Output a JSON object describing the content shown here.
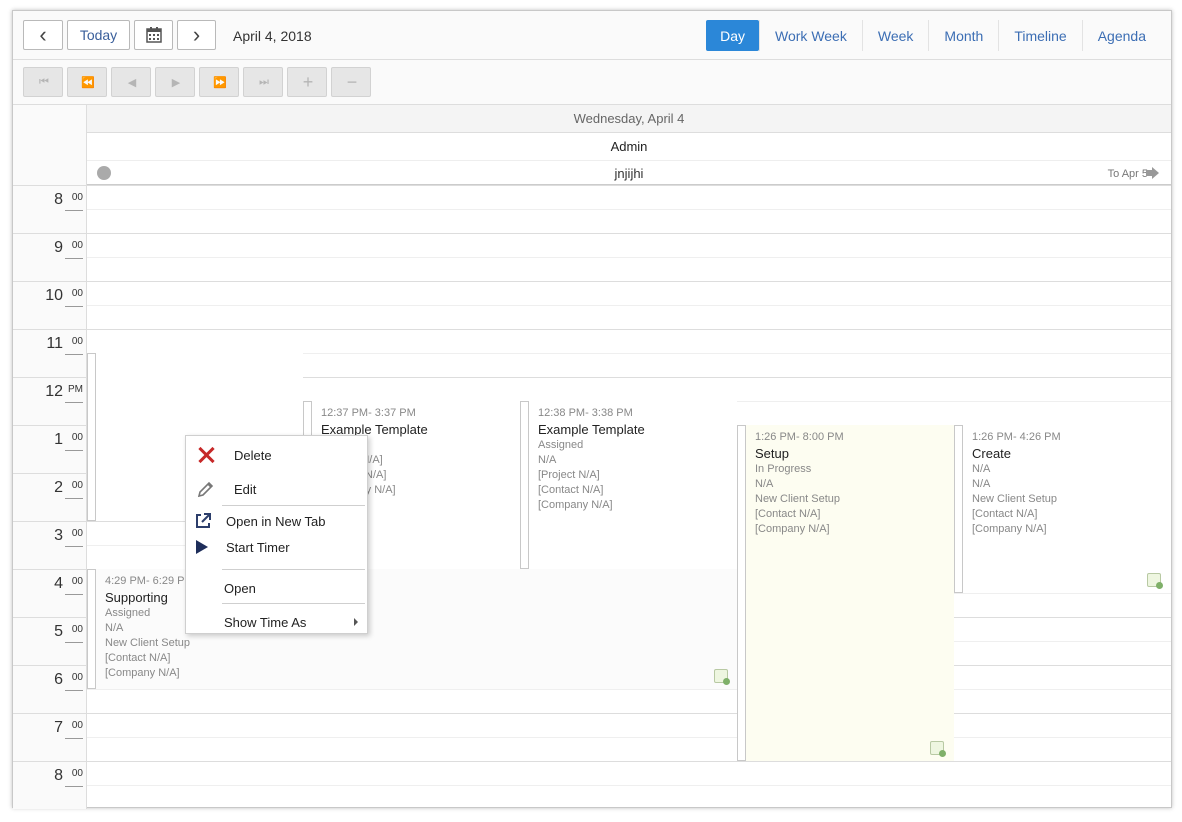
{
  "toolbar": {
    "prev": "‹",
    "today": "Today",
    "next": "›",
    "date": "April 4, 2018",
    "views": [
      "Day",
      "Work Week",
      "Week",
      "Month",
      "Timeline",
      "Agenda"
    ],
    "active_view": "Day"
  },
  "nav_buttons": [
    "⏮",
    "⏪",
    "◀",
    "▶",
    "⏩",
    "⏭",
    "+",
    "−"
  ],
  "header": {
    "day": "Wednesday, April 4",
    "resource": "Admin",
    "allday_event": "jnjijhi",
    "allday_continues": "To Apr 5"
  },
  "time_rows": [
    {
      "h": "8",
      "m": "00"
    },
    {
      "h": "9",
      "m": "00"
    },
    {
      "h": "10",
      "m": "00"
    },
    {
      "h": "11",
      "m": "00"
    },
    {
      "h": "12",
      "m": "PM"
    },
    {
      "h": "1",
      "m": "00"
    },
    {
      "h": "2",
      "m": "00"
    },
    {
      "h": "3",
      "m": "00"
    },
    {
      "h": "4",
      "m": "00"
    },
    {
      "h": "5",
      "m": "00"
    },
    {
      "h": "6",
      "m": "00"
    },
    {
      "h": "7",
      "m": "00"
    },
    {
      "h": "8",
      "m": "00"
    }
  ],
  "events": [
    {
      "time": "4:29 PM- 6:29 PM",
      "title": "Supporting",
      "lines": [
        "Assigned",
        "N/A",
        "New Client Setup",
        "[Contact N/A]",
        "[Company N/A]"
      ]
    },
    {
      "time": "12:37 PM- 3:37 PM",
      "title": "Example Template",
      "lines": [
        "",
        "[Project N/A]",
        "[Contact N/A]",
        "[Company N/A]"
      ]
    },
    {
      "time": "12:38 PM- 3:38 PM",
      "title": "Example Template",
      "lines": [
        "Assigned",
        "N/A",
        "[Project N/A]",
        "[Contact N/A]",
        "[Company N/A]"
      ]
    },
    {
      "time": "1:26 PM- 8:00 PM",
      "title": "Setup",
      "lines": [
        "In Progress",
        "N/A",
        "New Client Setup",
        "[Contact N/A]",
        "[Company N/A]"
      ]
    },
    {
      "time": "1:26 PM- 4:26 PM",
      "title": "Create",
      "lines": [
        "N/A",
        "N/A",
        "New Client Setup",
        "[Contact N/A]",
        "[Company N/A]"
      ]
    }
  ],
  "context_menu": {
    "delete": "Delete",
    "edit": "Edit",
    "open_new_tab": "Open in New Tab",
    "start_timer": "Start Timer",
    "open": "Open",
    "show_time_as": "Show Time As"
  },
  "colors": {
    "accent": "#2b87d8",
    "link": "#3c6eb4",
    "delete_icon": "#c62828",
    "setup_event_bg": "#fdfdf1"
  }
}
